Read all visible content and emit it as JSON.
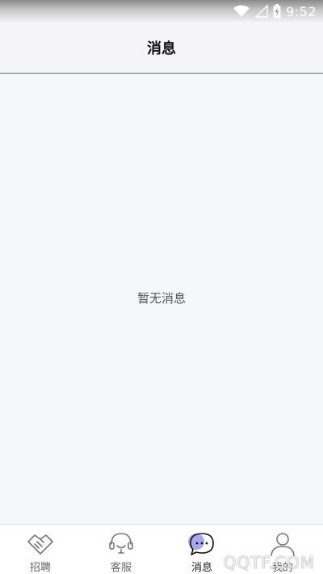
{
  "status_bar": {
    "time": "9:52",
    "icons": [
      "wifi-icon",
      "signal-icon",
      "battery-charging-icon"
    ]
  },
  "header": {
    "title": "消息"
  },
  "main": {
    "empty_text": "暂无消息"
  },
  "tab_bar": {
    "active_index": 2,
    "accent_color": "#a9a6f2",
    "items": [
      {
        "label": "招聘",
        "icon": "handshake-icon"
      },
      {
        "label": "客服",
        "icon": "headset-icon"
      },
      {
        "label": "消息",
        "icon": "chat-bubble-icon"
      },
      {
        "label": "我的",
        "icon": "person-icon"
      }
    ]
  },
  "watermark": {
    "text": "QQTF.COM"
  }
}
